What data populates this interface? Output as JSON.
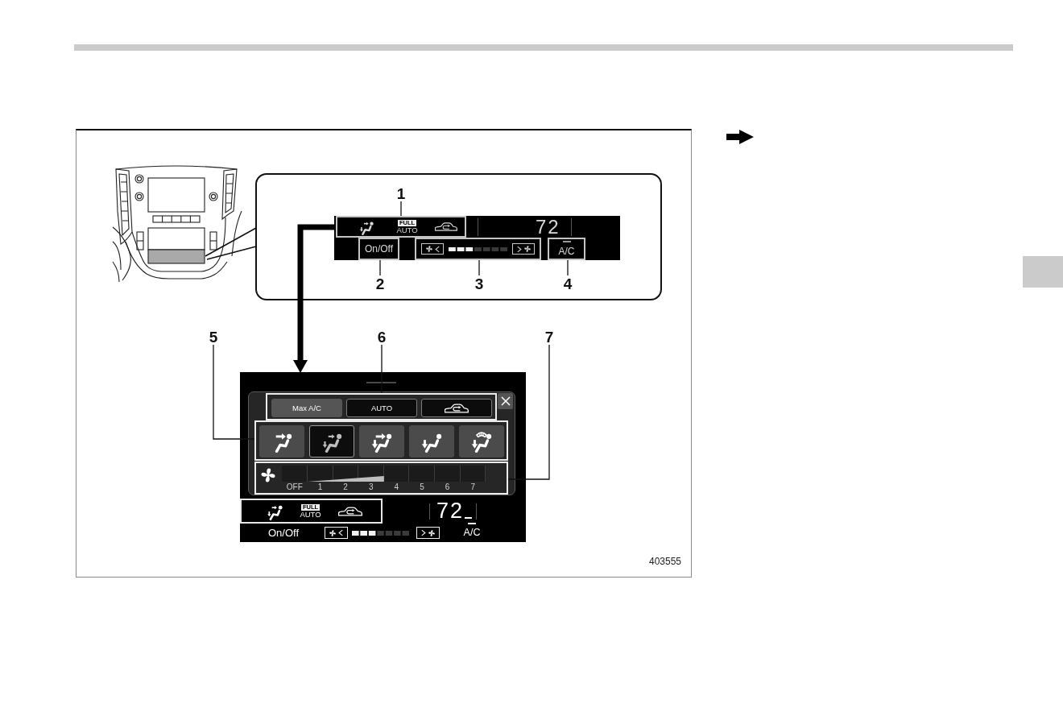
{
  "figure": {
    "callouts": [
      "1",
      "2",
      "3",
      "4",
      "5",
      "6",
      "7"
    ],
    "top_display": {
      "vent_mode": {
        "kind": "mixed"
      },
      "badge": "FULL",
      "mode_label": "AUTO",
      "temperature": "72",
      "power_button": "On/Off",
      "fan_meter": {
        "level": 0.43
      },
      "ac_button": {
        "label": "A/C",
        "indicator": true
      }
    },
    "screen": {
      "quick_buttons": [
        {
          "kind": "text",
          "label": "Max A/C",
          "on": false
        },
        {
          "kind": "text",
          "label": "AUTO",
          "on": true
        },
        {
          "kind": "recirculation",
          "on": true
        }
      ],
      "modes": [
        {
          "kind": "face",
          "selected": false
        },
        {
          "kind": "mixed",
          "selected": true
        },
        {
          "kind": "bilevel",
          "selected": false
        },
        {
          "kind": "floor",
          "selected": false
        },
        {
          "kind": "defrost",
          "selected": false
        }
      ],
      "fan_scale": {
        "labels": [
          "OFF",
          "1",
          "2",
          "3",
          "4",
          "5",
          "6",
          "7"
        ],
        "level": 0.43
      },
      "status": {
        "vent_mode": {
          "kind": "mixed"
        },
        "badge": "FULL",
        "mode_label": "AUTO",
        "temperature": "72",
        "power_button": "On/Off",
        "fan_meter": {
          "level": 0.43
        },
        "ac_button": {
          "label": "A/C",
          "indicator": true
        }
      }
    },
    "figure_code": "403555"
  }
}
